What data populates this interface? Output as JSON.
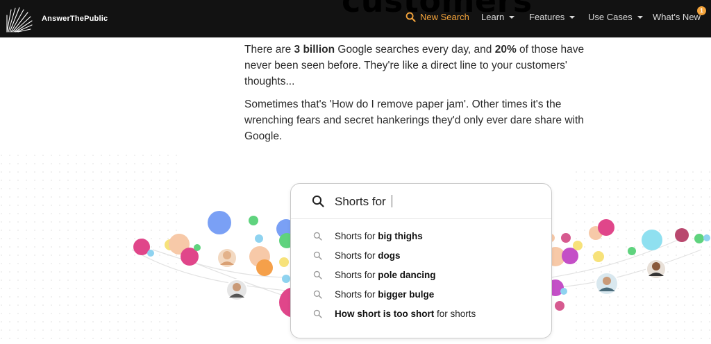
{
  "header": {
    "hero_word": "customers",
    "logo_text": "AnswerThePublic",
    "nav": [
      {
        "label": "New Search"
      },
      {
        "label": "Learn"
      },
      {
        "label": "Features"
      },
      {
        "label": "Use Cases"
      },
      {
        "label": "What's New",
        "badge": "1"
      }
    ],
    "accent_color": "#f3a33b"
  },
  "intro": {
    "p1_a": "There are ",
    "p1_b": "3 billion",
    "p1_c": " Google searches every day, and ",
    "p1_d": "20%",
    "p1_e": " of those have never been seen before. They're like a direct line to your customers' thoughts...",
    "p2": "Sometimes that's 'How do I remove paper jam'. Other times it's the wrenching fears and secret hankerings they'd only ever dare share with Google."
  },
  "search": {
    "query": "Shorts for",
    "suggestions": [
      {
        "prefix": "Shorts for ",
        "bold": "big thighs",
        "suffix": ""
      },
      {
        "prefix": "Shorts for ",
        "bold": "dogs",
        "suffix": ""
      },
      {
        "prefix": "Shorts for ",
        "bold": "pole dancing",
        "suffix": ""
      },
      {
        "prefix": "Shorts for ",
        "bold": "bigger bulge",
        "suffix": ""
      },
      {
        "prefix": "",
        "bold": "How short is too short",
        "suffix": " for shorts"
      }
    ]
  }
}
